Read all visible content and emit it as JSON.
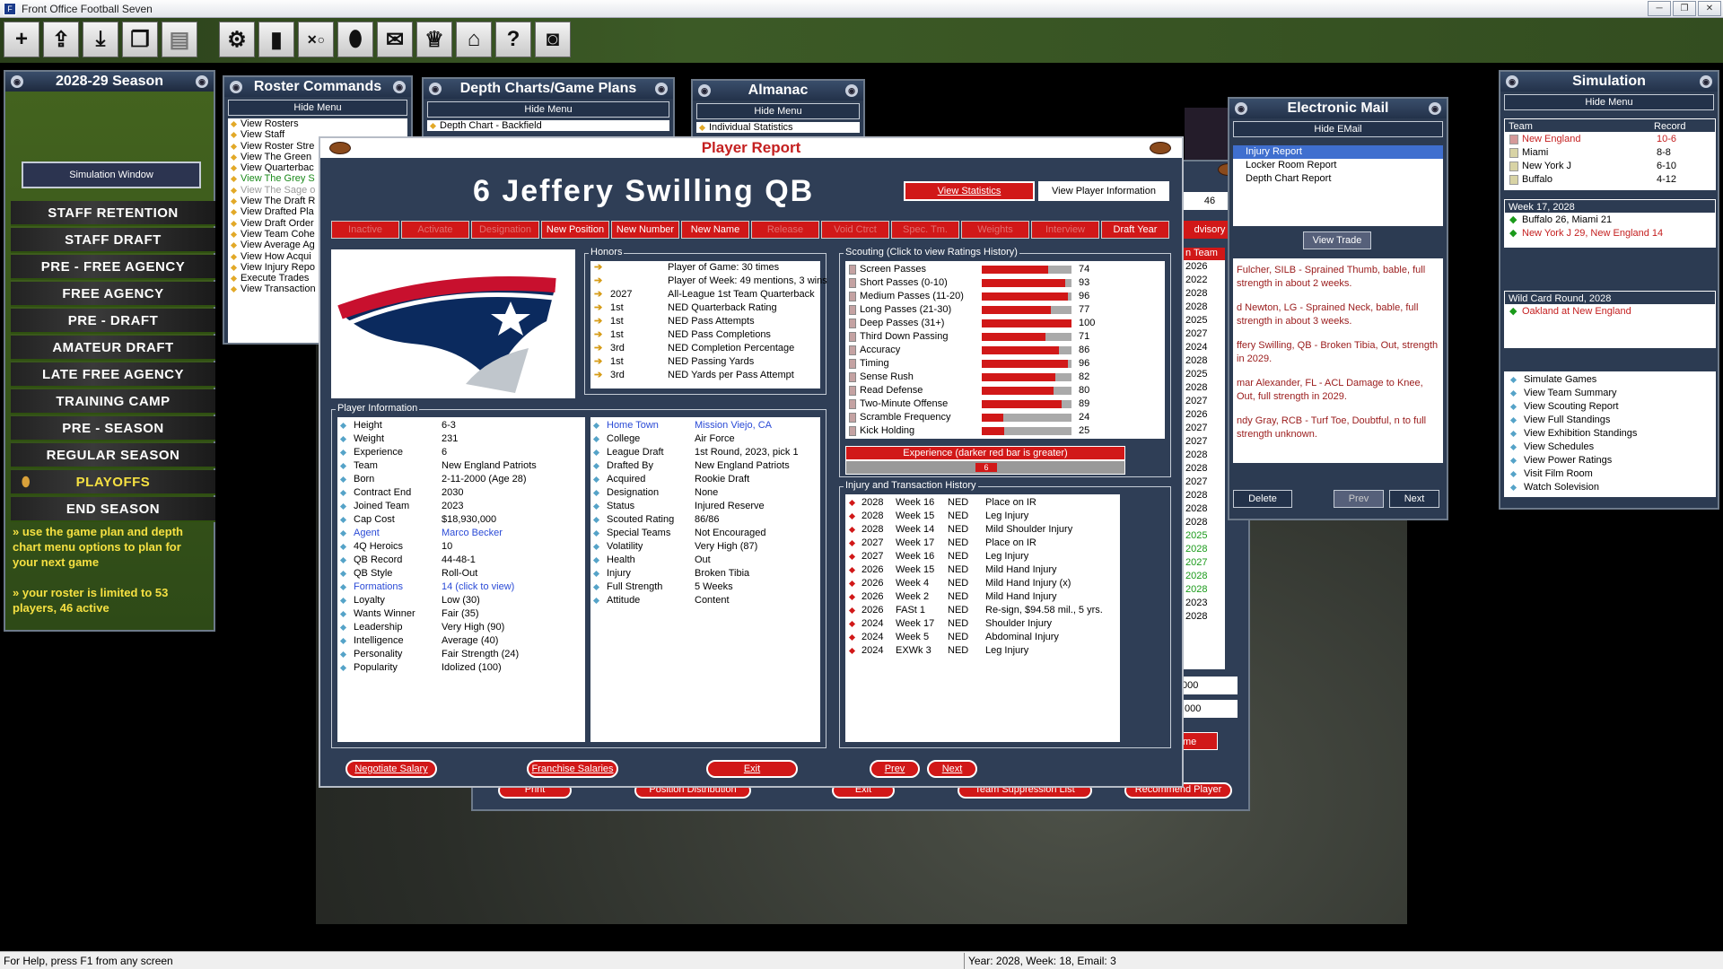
{
  "window": {
    "title": "Front Office Football Seven"
  },
  "toolbar": {
    "icons": [
      "plus-icon",
      "upload-icon",
      "download-icon",
      "copy-icon",
      "document-icon",
      "gear-icon",
      "clipboard-icon",
      "playbook-icon",
      "football-icon",
      "mail-icon",
      "trophy-icon",
      "stadium-icon",
      "help-icon",
      "camera-icon"
    ]
  },
  "season": {
    "title": "2028-29 Season",
    "sim_window": "Simulation Window",
    "stages": [
      "STAFF RETENTION",
      "STAFF DRAFT",
      "PRE - FREE AGENCY",
      "FREE AGENCY",
      "PRE - DRAFT",
      "AMATEUR DRAFT",
      "LATE FREE AGENCY",
      "TRAINING CAMP",
      "PRE - SEASON",
      "REGULAR SEASON",
      "PLAYOFFS",
      "END SEASON"
    ],
    "tip1": "» use the game plan and depth chart menu options to plan for your next game",
    "tip2": "» your roster is limited to 53 players, 46 active"
  },
  "roster": {
    "title": "Roster Commands",
    "hide": "Hide Menu",
    "items": [
      "View Rosters",
      "View Staff",
      "View Roster Stre",
      "View The Green",
      "View Quarterbac",
      "View The Grey S",
      "View The Sage o",
      "View The Draft R",
      "View Drafted Pla",
      "View Draft Order",
      "View Team Cohe",
      "View Average Ag",
      "View How Acqui",
      "View Injury Repo",
      "Execute Trades",
      "View Transaction"
    ]
  },
  "depth": {
    "title": "Depth Charts/Game Plans",
    "hide": "Hide Menu",
    "items": [
      "Depth Chart - Backfield"
    ]
  },
  "almanac": {
    "title": "Almanac",
    "hide": "Hide Menu",
    "items": [
      "Individual Statistics"
    ]
  },
  "report": {
    "title": "Player Report",
    "player": "6  Jeffery Swilling  QB",
    "view_stats": "View Statistics",
    "view_info": "View Player Information",
    "actions": [
      "Inactive",
      "Activate",
      "Designation",
      "New Position",
      "New Number",
      "New Name",
      "Release",
      "Void Ctrct",
      "Spec. Tm.",
      "Weights",
      "Interview",
      "Draft Year"
    ],
    "honors_label": "Honors",
    "honors": [
      {
        "year": "",
        "rank": "",
        "text": "Player of Game: 30 times"
      },
      {
        "year": "",
        "rank": "",
        "text": "Player of Week: 49 mentions, 3 wins"
      },
      {
        "year": "2027",
        "rank": "",
        "text": "All-League 1st Team Quarterback"
      },
      {
        "year": "1st",
        "rank": "",
        "text": "NED Quarterback Rating"
      },
      {
        "year": "1st",
        "rank": "",
        "text": "NED Pass Attempts"
      },
      {
        "year": "1st",
        "rank": "",
        "text": "NED Pass Completions"
      },
      {
        "year": "3rd",
        "rank": "",
        "text": "NED Completion Percentage"
      },
      {
        "year": "1st",
        "rank": "",
        "text": "NED Passing Yards"
      },
      {
        "year": "3rd",
        "rank": "",
        "text": "NED Yards per Pass Attempt"
      }
    ],
    "info_label": "Player Information",
    "info_left": [
      {
        "k": "Height",
        "v": "6-3"
      },
      {
        "k": "Weight",
        "v": "231"
      },
      {
        "k": "Experience",
        "v": "6"
      },
      {
        "k": "Team",
        "v": "New England Patriots"
      },
      {
        "k": "Born",
        "v": "2-11-2000 (Age 28)"
      },
      {
        "k": "Contract End",
        "v": "2030"
      },
      {
        "k": "Joined Team",
        "v": "2023"
      },
      {
        "k": "Cap Cost",
        "v": "$18,930,000"
      },
      {
        "k": "Agent",
        "v": "Marco Becker",
        "link": true
      },
      {
        "k": "4Q Heroics",
        "v": "10"
      },
      {
        "k": "QB Record",
        "v": "44-48-1"
      },
      {
        "k": "QB Style",
        "v": "Roll-Out"
      },
      {
        "k": "Formations",
        "v": "14 (click to view)",
        "link": true
      },
      {
        "k": "Loyalty",
        "v": "Low (30)"
      },
      {
        "k": "Wants Winner",
        "v": "Fair (35)"
      },
      {
        "k": "Leadership",
        "v": "Very High (90)"
      },
      {
        "k": "Intelligence",
        "v": "Average (40)"
      },
      {
        "k": "Personality",
        "v": "Fair Strength (24)"
      },
      {
        "k": "Popularity",
        "v": "Idolized (100)"
      }
    ],
    "info_right": [
      {
        "k": "Home Town",
        "v": "Mission Viejo, CA",
        "link": true
      },
      {
        "k": "College",
        "v": "Air Force"
      },
      {
        "k": "League Draft",
        "v": "1st Round, 2023, pick 1"
      },
      {
        "k": "Drafted By",
        "v": "New England Patriots"
      },
      {
        "k": "Acquired",
        "v": "Rookie Draft"
      },
      {
        "k": "Designation",
        "v": "None"
      },
      {
        "k": "Status",
        "v": "Injured Reserve"
      },
      {
        "k": "Scouted Rating",
        "v": "86/86"
      },
      {
        "k": "Special Teams",
        "v": "Not Encouraged"
      },
      {
        "k": "Volatility",
        "v": "Very High (87)"
      },
      {
        "k": "Health",
        "v": "Out"
      },
      {
        "k": "Injury",
        "v": "Broken Tibia"
      },
      {
        "k": "Full Strength",
        "v": "5 Weeks"
      },
      {
        "k": "Attitude",
        "v": "Content"
      }
    ],
    "scouting_label": "Scouting (Click to view Ratings History)",
    "scouting": [
      {
        "name": "Screen Passes",
        "value": 74
      },
      {
        "name": "Short Passes (0-10)",
        "value": 93
      },
      {
        "name": "Medium Passes (11-20)",
        "value": 96
      },
      {
        "name": "Long Passes (21-30)",
        "value": 77
      },
      {
        "name": "Deep Passes (31+)",
        "value": 100
      },
      {
        "name": "Third Down Passing",
        "value": 71
      },
      {
        "name": "Accuracy",
        "value": 86
      },
      {
        "name": "Timing",
        "value": 96
      },
      {
        "name": "Sense Rush",
        "value": 82
      },
      {
        "name": "Read Defense",
        "value": 80
      },
      {
        "name": "Two-Minute Offense",
        "value": 89
      },
      {
        "name": "Scramble Frequency",
        "value": 24
      },
      {
        "name": "Kick Holding",
        "value": 25
      }
    ],
    "experience_label": "Experience (darker red bar is greater)",
    "experience_value": "6",
    "injury_label": "Injury and Transaction History",
    "injuries": [
      {
        "y": "2028",
        "w": "Week 16",
        "t": "NED",
        "d": "Place on IR"
      },
      {
        "y": "2028",
        "w": "Week 15",
        "t": "NED",
        "d": "Leg Injury"
      },
      {
        "y": "2028",
        "w": "Week 14",
        "t": "NED",
        "d": "Mild Shoulder Injury"
      },
      {
        "y": "2027",
        "w": "Week 17",
        "t": "NED",
        "d": "Place on IR"
      },
      {
        "y": "2027",
        "w": "Week 16",
        "t": "NED",
        "d": "Leg Injury"
      },
      {
        "y": "2026",
        "w": "Week 15",
        "t": "NED",
        "d": "Mild Hand Injury"
      },
      {
        "y": "2026",
        "w": "Week 4",
        "t": "NED",
        "d": "Mild Hand Injury (x)"
      },
      {
        "y": "2026",
        "w": "Week 2",
        "t": "NED",
        "d": "Mild Hand Injury"
      },
      {
        "y": "2026",
        "w": "FASt 1",
        "t": "NED",
        "d": "Re-sign, $94.58 mil., 5 yrs."
      },
      {
        "y": "2024",
        "w": "Week 17",
        "t": "NED",
        "d": "Shoulder Injury"
      },
      {
        "y": "2024",
        "w": "Week 5",
        "t": "NED",
        "d": "Abdominal Injury"
      },
      {
        "y": "2024",
        "w": "EXWk 3",
        "t": "NED",
        "d": "Leg Injury"
      }
    ],
    "buttons": {
      "negotiate": "Negotiate Salary",
      "franchise": "Franchise Salaries",
      "exit": "Exit",
      "prev": "Prev",
      "next": "Next"
    }
  },
  "behind": {
    "num": "46",
    "advisory": "dvisory",
    "team": "n Team",
    "years": [
      "2026",
      "2022",
      "2028",
      "2028",
      "2025",
      "2027",
      "2024",
      "2028",
      "2025",
      "2028",
      "2027",
      "2026",
      "2027",
      "2027",
      "2028",
      "2028",
      "2027",
      "2028",
      "2028",
      "2028",
      "2025",
      "2028",
      "2027",
      "2028",
      "2028",
      "2023",
      "2028"
    ],
    "money1": "000",
    "money2": ",000",
    "me": "me",
    "bottom": [
      "Print",
      "Position Distribution",
      "Exit",
      "Team Suppression List",
      "Recommend Player"
    ]
  },
  "email": {
    "title": "Electronic Mail",
    "hide": "Hide EMail",
    "items": [
      "Injury Report",
      "Locker Room Report",
      "Depth Chart Report"
    ],
    "view_trade": "View Trade",
    "body": [
      "Fulcher, SILB - Sprained Thumb, bable, full strength in about 2 weeks.",
      "d Newton, LG - Sprained Neck, bable, full strength in about 3 weeks.",
      "ffery Swilling, QB - Broken Tibia, Out, strength in 2029.",
      "mar Alexander, FL - ACL Damage to Knee, Out, full strength in 2029.",
      "ndy Gray, RCB - Turf Toe, Doubtful, n to full strength unknown."
    ],
    "delete": "Delete",
    "prev": "Prev",
    "next": "Next"
  },
  "simulation": {
    "title": "Simulation",
    "hide": "Hide Menu",
    "standings_head": {
      "team": "Team",
      "record": "Record"
    },
    "standings": [
      {
        "team": "New England",
        "record": "10-6",
        "red": true
      },
      {
        "team": "Miami",
        "record": "8-8"
      },
      {
        "team": "New York J",
        "record": "6-10"
      },
      {
        "team": "Buffalo",
        "record": "4-12"
      }
    ],
    "week_title": "Week 17, 2028",
    "week_games": [
      "Buffalo 26, Miami 21",
      "New York J 29, New England 14"
    ],
    "wild_title": "Wild Card Round, 2028",
    "wild_games": [
      "Oakland at New England"
    ],
    "menu": [
      "Simulate Games",
      "View Team Summary",
      "View Scouting Report",
      "View Full Standings",
      "View Exhibition Standings",
      "View Schedules",
      "View Power Ratings",
      "Visit Film Room",
      "Watch Solevision"
    ]
  },
  "status": {
    "help": "For Help, press F1 from any screen",
    "info": "Year: 2028, Week: 18, Email: 3"
  }
}
